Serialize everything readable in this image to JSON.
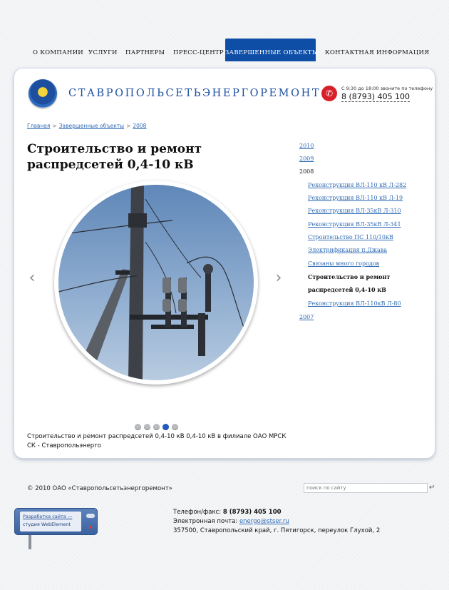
{
  "nav": [
    {
      "label": "О КОМПАНИИ"
    },
    {
      "label": "УСЛУГИ"
    },
    {
      "label": "ПАРТНЕРЫ"
    },
    {
      "label": "ПРЕСС-ЦЕНТР"
    },
    {
      "label": "ЗАВЕРШЕННЫЕ ОБЪЕКТЫ",
      "active": true
    },
    {
      "label": "КОНТАКТНАЯ ИНФОРМАЦИЯ"
    }
  ],
  "header": {
    "brand": "СТАВРОПОЛЬСЕТЬЭНЕРГОРЕМОНТ",
    "logo_icon": "company-logo-icon",
    "phone_hint": "С 9:30 до 18:00 звоните по телефону",
    "phone_number": "8 (8793) 405 100",
    "phone_icon": "phone-icon",
    "accent_color": "#0e4ea6",
    "phone_color": "#d7202a"
  },
  "breadcrumb": {
    "items": [
      "Главная",
      "Завершенные объекты",
      "2008"
    ],
    "separator": ">"
  },
  "page": {
    "title": "Строительство и ремонт распредсетей 0,4-10 кВ",
    "caption": "Строительство и ремонт распредсетей 0,4-10 кВ 0,4-10 кВ в филиале ОАО МРСК СК - Ставропольэнерго",
    "slideshow": {
      "prev_icon": "chevron-left-icon",
      "next_icon": "chevron-right-icon",
      "slide_count": 5,
      "active_slide": 4
    }
  },
  "sidebar": {
    "years": [
      {
        "label": "2010"
      },
      {
        "label": "2009"
      },
      {
        "label": "2008",
        "current": true
      },
      {
        "label": "2007"
      }
    ],
    "projects_2008": [
      {
        "label": "Реконструкция ВЛ-110 кВ Л-282"
      },
      {
        "label": "Реконструкция ВЛ-110 кВ Л-19"
      },
      {
        "label": "Реконструкция ВЛ-35кВ Л-310"
      },
      {
        "label": "Реконструкция ВЛ-35кВ Л-341"
      },
      {
        "label": "Строительство ПС 110/10кВ"
      },
      {
        "label": "Электрификация п.Джава"
      },
      {
        "label": "Связаны много городов"
      },
      {
        "label": "Строительство и ремонт распредсетей 0,4-10 кВ",
        "current": true
      },
      {
        "label": "Реконструкция ВЛ-110кВ Л-80"
      }
    ]
  },
  "footer": {
    "copyright": "© 2010 ОАО «Ставропольсетьэнергоремонт»",
    "search_placeholder": "поиск по сайту",
    "dev_line1": "Разработка сайта —",
    "dev_line2": "студия WebElement",
    "phone_label": "Телефон/факс:",
    "phone_value": "8 (8793) 405 100",
    "email_label": "Электронная почта:",
    "email_value": "energo@stser.ru",
    "address": "357500, Ставропольский край, г. Пятигорск, переулок Глухой, 2"
  }
}
